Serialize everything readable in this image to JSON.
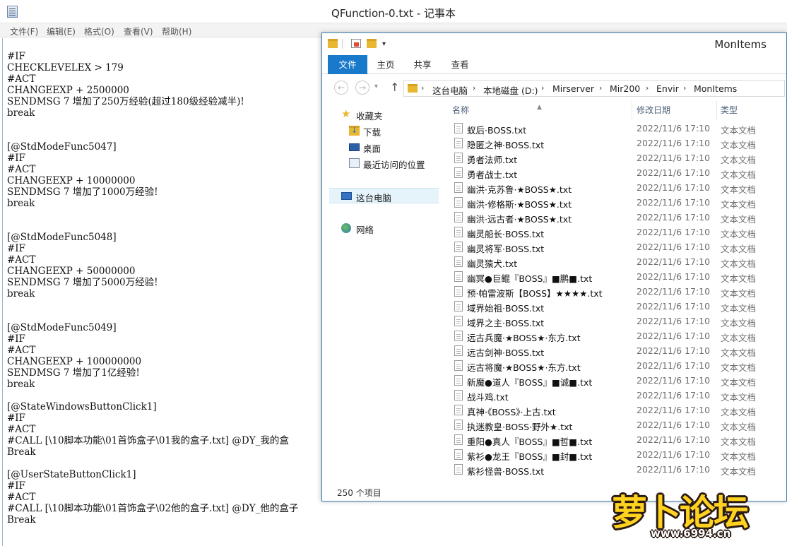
{
  "notepad": {
    "title": "QFunction-0.txt - 记事本",
    "menu": [
      "文件(F)",
      "编辑(E)",
      "格式(O)",
      "查看(V)",
      "帮助(H)"
    ],
    "lines": [
      "#IF",
      "CHECKLEVELEX > 179",
      "#ACT",
      "CHANGEEXP + 2500000",
      "SENDMSG 7 增加了250万经验(超过180级经验减半)!",
      "break",
      "",
      "",
      "[@StdModeFunc5047]",
      "#IF",
      "#ACT",
      "CHANGEEXP + 10000000",
      "SENDMSG 7 增加了1000万经验!",
      "break",
      "",
      "",
      "[@StdModeFunc5048]",
      "#IF",
      "#ACT",
      "CHANGEEXP + 50000000",
      "SENDMSG 7 增加了5000万经验!",
      "break",
      "",
      "",
      "[@StdModeFunc5049]",
      "#IF",
      "#ACT",
      "CHANGEEXP + 100000000",
      "SENDMSG 7 增加了1亿经验!",
      "break",
      "",
      "[@StateWindowsButtonClick1]",
      "#IF",
      "#ACT",
      "#CALL [\\10脚本功能\\01首饰盒子\\01我的盒子.txt] @DY_我的盒",
      "Break",
      "",
      "[@UserStateButtonClick1]",
      "#IF",
      "#ACT",
      "#CALL [\\10脚本功能\\01首饰盒子\\02他的盒子.txt] @DY_他的盒子",
      "Break"
    ]
  },
  "explorer": {
    "title": "MonItems",
    "ribbon_tabs": [
      "文件",
      "主页",
      "共享",
      "查看"
    ],
    "breadcrumb": [
      "这台电脑",
      "本地磁盘 (D:)",
      "Mirserver",
      "Mir200",
      "Envir",
      "MonItems"
    ],
    "sidebar": {
      "favorites": "收藏夹",
      "downloads": "下载",
      "desktop": "桌面",
      "recent": "最近访问的位置",
      "this_pc": "这台电脑",
      "network": "网络"
    },
    "columns": [
      "名称",
      "修改日期",
      "类型"
    ],
    "files": [
      {
        "name": "蚁后·BOSS.txt",
        "date": "2022/11/6 17:10",
        "type": "文本文档"
      },
      {
        "name": "隐匿之神·BOSS.txt",
        "date": "2022/11/6 17:10",
        "type": "文本文档"
      },
      {
        "name": "勇者法师.txt",
        "date": "2022/11/6 17:10",
        "type": "文本文档"
      },
      {
        "name": "勇者战士.txt",
        "date": "2022/11/6 17:10",
        "type": "文本文档"
      },
      {
        "name": "幽洪·克苏鲁·★BOSS★.txt",
        "date": "2022/11/6 17:10",
        "type": "文本文档"
      },
      {
        "name": "幽洪·修格斯·★BOSS★.txt",
        "date": "2022/11/6 17:10",
        "type": "文本文档"
      },
      {
        "name": "幽洪·远古者·★BOSS★.txt",
        "date": "2022/11/6 17:10",
        "type": "文本文档"
      },
      {
        "name": "幽灵船长·BOSS.txt",
        "date": "2022/11/6 17:10",
        "type": "文本文档"
      },
      {
        "name": "幽灵将军·BOSS.txt",
        "date": "2022/11/6 17:10",
        "type": "文本文档"
      },
      {
        "name": "幽灵猿犬.txt",
        "date": "2022/11/6 17:10",
        "type": "文本文档"
      },
      {
        "name": "幽冥●巨鲲『BOSS』■鹏■.txt",
        "date": "2022/11/6 17:10",
        "type": "文本文档"
      },
      {
        "name": "预·帕雷波斯【BOSS】★★★★.txt",
        "date": "2022/11/6 17:10",
        "type": "文本文档"
      },
      {
        "name": "域界始祖·BOSS.txt",
        "date": "2022/11/6 17:10",
        "type": "文本文档"
      },
      {
        "name": "域界之主·BOSS.txt",
        "date": "2022/11/6 17:10",
        "type": "文本文档"
      },
      {
        "name": "远古兵魔·★BOSS★·东方.txt",
        "date": "2022/11/6 17:10",
        "type": "文本文档"
      },
      {
        "name": "远古剑神·BOSS.txt",
        "date": "2022/11/6 17:10",
        "type": "文本文档"
      },
      {
        "name": "远古将魔·★BOSS★·东方.txt",
        "date": "2022/11/6 17:10",
        "type": "文本文档"
      },
      {
        "name": "新魔●道人『BOSS』■诚■.txt",
        "date": "2022/11/6 17:10",
        "type": "文本文档"
      },
      {
        "name": "战斗鸡.txt",
        "date": "2022/11/6 17:10",
        "type": "文本文档"
      },
      {
        "name": "真神·《BOSS》·上古.txt",
        "date": "2022/11/6 17:10",
        "type": "文本文档"
      },
      {
        "name": "执迷教皇·BOSS·野外★.txt",
        "date": "2022/11/6 17:10",
        "type": "文本文档"
      },
      {
        "name": "重阳●真人『BOSS』■哲■.txt",
        "date": "2022/11/6 17:10",
        "type": "文本文档"
      },
      {
        "name": "紫衫●龙王『BOSS』■封■.txt",
        "date": "2022/11/6 17:10",
        "type": "文本文档"
      },
      {
        "name": "紫衫怪兽·BOSS.txt",
        "date": "2022/11/6 17:10",
        "type": "文本文档"
      }
    ],
    "status": "250 个项目"
  },
  "watermark": {
    "text": "萝卜论坛",
    "url": "www.6994.cn"
  }
}
